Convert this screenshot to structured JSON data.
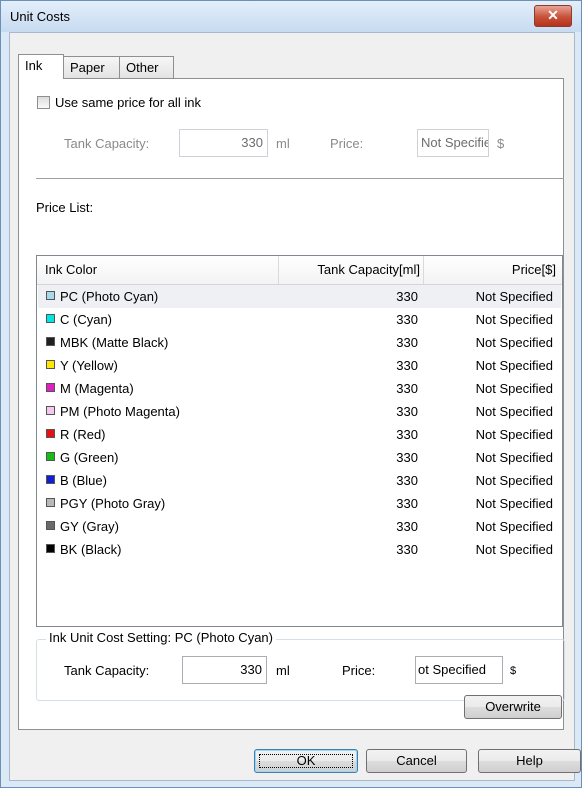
{
  "window": {
    "title": "Unit Costs",
    "close_label": "✕"
  },
  "tabs": [
    {
      "label": "Ink",
      "active": true
    },
    {
      "label": "Paper",
      "active": false
    },
    {
      "label": "Other",
      "active": false
    }
  ],
  "same_price": {
    "label": "Use same price for all ink",
    "checked": false,
    "tank_capacity_label": "Tank Capacity:",
    "tank_capacity_value": "330",
    "tank_unit": "ml",
    "price_label": "Price:",
    "price_value": "Not Specifie",
    "price_unit": "$"
  },
  "price_list": {
    "label": "Price List:",
    "columns": [
      "Ink Color",
      "Tank Capacity[ml]",
      "Price[$]"
    ],
    "rows": [
      {
        "name": "PC (Photo Cyan)",
        "color": "#a8d8ea",
        "capacity": "330",
        "price": "Not Specified"
      },
      {
        "name": "C (Cyan)",
        "color": "#00e5e5",
        "capacity": "330",
        "price": "Not Specified"
      },
      {
        "name": "MBK (Matte Black)",
        "color": "#202020",
        "capacity": "330",
        "price": "Not Specified"
      },
      {
        "name": "Y (Yellow)",
        "color": "#ffe600",
        "capacity": "330",
        "price": "Not Specified"
      },
      {
        "name": "M (Magenta)",
        "color": "#e020c0",
        "capacity": "330",
        "price": "Not Specified"
      },
      {
        "name": "PM (Photo Magenta)",
        "color": "#f4c8ee",
        "capacity": "330",
        "price": "Not Specified"
      },
      {
        "name": "R (Red)",
        "color": "#e81010",
        "capacity": "330",
        "price": "Not Specified"
      },
      {
        "name": "G (Green)",
        "color": "#10c010",
        "capacity": "330",
        "price": "Not Specified"
      },
      {
        "name": "B (Blue)",
        "color": "#1020d0",
        "capacity": "330",
        "price": "Not Specified"
      },
      {
        "name": "PGY (Photo Gray)",
        "color": "#b8b8b8",
        "capacity": "330",
        "price": "Not Specified"
      },
      {
        "name": "GY (Gray)",
        "color": "#6a6a6a",
        "capacity": "330",
        "price": "Not Specified"
      },
      {
        "name": "BK (Black)",
        "color": "#000000",
        "capacity": "330",
        "price": "Not Specified"
      }
    ]
  },
  "setting": {
    "title": "Ink Unit Cost Setting: PC (Photo Cyan)",
    "tank_capacity_label": "Tank Capacity:",
    "tank_capacity_value": "330",
    "tank_unit": "ml",
    "price_label": "Price:",
    "price_value": "ot Specified",
    "price_unit": "$",
    "overwrite_label": "Overwrite"
  },
  "footer": {
    "ok_label": "OK",
    "cancel_label": "Cancel",
    "help_label": "Help"
  }
}
